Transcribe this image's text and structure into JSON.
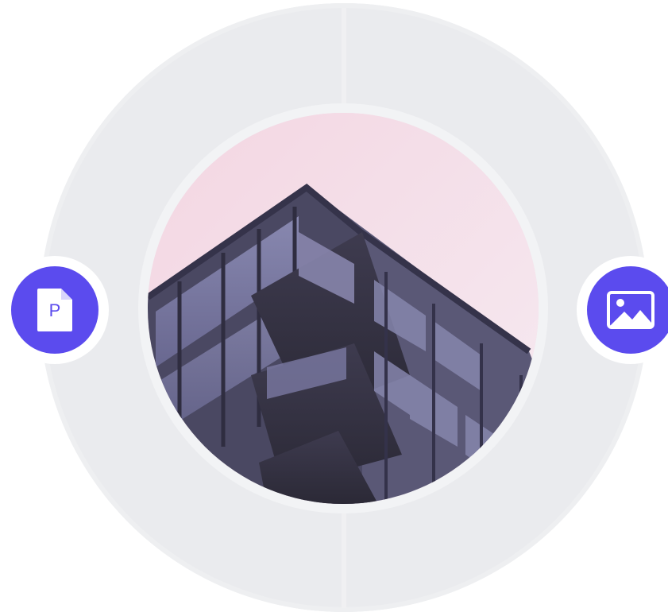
{
  "scene": {
    "description_icons": {
      "left_badge_icon": "pdf-file-icon",
      "right_badge_icon": "image-icon"
    },
    "left_badge": {
      "letter": "P"
    }
  },
  "colors": {
    "accent": "#5b4bee",
    "ring": "#eaebee",
    "sky": "#f1dbe5"
  }
}
